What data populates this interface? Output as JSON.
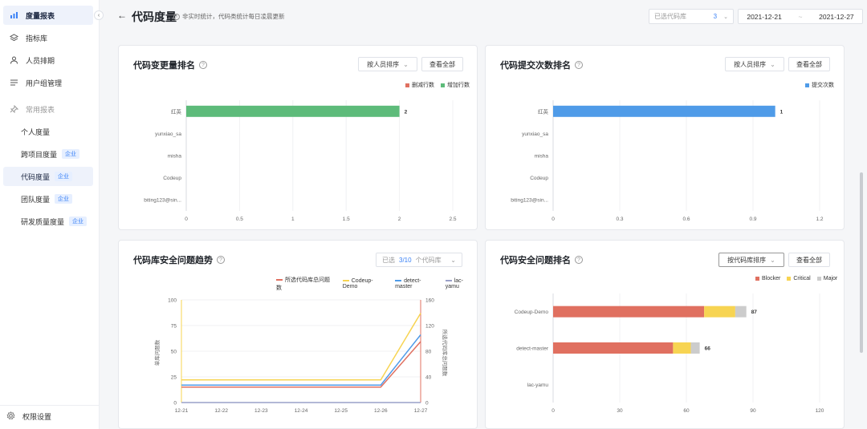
{
  "sidebar": {
    "items": [
      {
        "label": "度量报表",
        "icon": "chart-bars-icon",
        "active": true
      },
      {
        "label": "指标库",
        "icon": "layers-icon"
      },
      {
        "label": "人员排期",
        "icon": "user-icon"
      },
      {
        "label": "用户组管理",
        "icon": "list-icon"
      }
    ],
    "section_label": "常用报表",
    "section_icon": "pin-icon",
    "sub_items": [
      {
        "label": "个人度量",
        "badge": ""
      },
      {
        "label": "跨项目度量",
        "badge": "企业"
      },
      {
        "label": "代码度量",
        "badge": "企业",
        "active": true
      },
      {
        "label": "团队度量",
        "badge": "企业"
      },
      {
        "label": "研发质量度量",
        "badge": "企业"
      }
    ],
    "settings_label": "权限设置",
    "collapse_icon": "chevron-left-icon"
  },
  "header": {
    "back_icon": "arrow-left-icon",
    "title": "代码度量",
    "note": "非实时统计，代码类统计每日凌晨更新",
    "repo_placeholder": "已选代码库",
    "repo_count": "3",
    "date_start": "2021-12-21",
    "date_sep": "~",
    "date_end": "2021-12-27"
  },
  "cards": {
    "change": {
      "title": "代码变更量排名",
      "sort_label": "按人员排序",
      "view_all": "查看全部",
      "legend": [
        "删减行数",
        "增加行数"
      ]
    },
    "commit": {
      "title": "代码提交次数排名",
      "sort_label": "按人员排序",
      "view_all": "查看全部",
      "legend": [
        "提交次数"
      ]
    },
    "trend": {
      "title": "代码库安全问题趋势",
      "sel_prefix": "已选",
      "sel_count": "3/10",
      "sel_suffix": "个代码库",
      "legend": [
        "所选代码库总问题数",
        "Codeup-Demo",
        "detect-master",
        "lac-yamu"
      ],
      "ylabel_left": "单库问题数",
      "ylabel_right": "所选代码库总问题数"
    },
    "security": {
      "title": "代码安全问题排名",
      "sort_label": "按代码库排序",
      "view_all": "查看全部",
      "legend": [
        "Blocker",
        "Critical",
        "Major"
      ]
    }
  },
  "colors": {
    "green": "#5dbb7a",
    "blue": "#4f9be8",
    "red": "#e07060",
    "yellow": "#f7d452",
    "gray": "#cccccc",
    "accent": "#3b82f6"
  },
  "chart_data": [
    {
      "type": "bar",
      "orientation": "horizontal",
      "categories": [
        "红英",
        "yunxiao_sa",
        "misha",
        "Codeup",
        "biting123@sin..."
      ],
      "series": [
        {
          "name": "删减行数",
          "values": [
            0,
            0,
            0,
            0,
            0
          ]
        },
        {
          "name": "增加行数",
          "values": [
            2,
            0,
            0,
            0,
            0
          ]
        }
      ],
      "data_labels": [
        "2",
        "",
        "",
        "",
        ""
      ],
      "xticks": [
        "0",
        "0.5",
        "1",
        "1.5",
        "2",
        "2.5"
      ],
      "xlim": [
        0,
        2.5
      ]
    },
    {
      "type": "bar",
      "orientation": "horizontal",
      "categories": [
        "红英",
        "yunxiao_sa",
        "misha",
        "Codeup",
        "biting123@sin..."
      ],
      "series": [
        {
          "name": "提交次数",
          "values": [
            1,
            0,
            0,
            0,
            0
          ]
        }
      ],
      "data_labels": [
        "1",
        "",
        "",
        "",
        ""
      ],
      "xticks": [
        "0",
        "0.3",
        "0.6",
        "0.9",
        "1.2"
      ],
      "xlim": [
        0,
        1.2
      ]
    },
    {
      "type": "line",
      "x": [
        "12-21",
        "12-22",
        "12-23",
        "12-24",
        "12-25",
        "12-26",
        "12-27"
      ],
      "series": [
        {
          "name": "所选代码库总问题数",
          "axis": "right",
          "values": [
            24,
            24,
            24,
            24,
            24,
            24,
            95
          ]
        },
        {
          "name": "Codeup-Demo",
          "axis": "left",
          "values": [
            22,
            22,
            22,
            22,
            22,
            22,
            87
          ]
        },
        {
          "name": "detect-master",
          "axis": "left",
          "values": [
            17,
            17,
            17,
            17,
            17,
            17,
            66
          ]
        },
        {
          "name": "lac-yamu",
          "axis": "left",
          "values": [
            0,
            0,
            0,
            0,
            0,
            0,
            0
          ]
        }
      ],
      "yticks_left": [
        "0",
        "25",
        "50",
        "75",
        "100"
      ],
      "yticks_right": [
        "0",
        "40",
        "80",
        "120",
        "160"
      ],
      "ylim_left": [
        0,
        100
      ],
      "ylim_right": [
        0,
        160
      ]
    },
    {
      "type": "bar",
      "orientation": "horizontal",
      "stacked": true,
      "categories": [
        "Codeup-Demo",
        "detect-master",
        "lac-yamu"
      ],
      "series": [
        {
          "name": "Blocker",
          "values": [
            68,
            54,
            0
          ]
        },
        {
          "name": "Critical",
          "values": [
            14,
            8,
            0
          ]
        },
        {
          "name": "Major",
          "values": [
            5,
            4,
            0
          ]
        }
      ],
      "data_labels": [
        "87",
        "66",
        ""
      ],
      "xticks": [
        "0",
        "30",
        "60",
        "90",
        "120"
      ],
      "xlim": [
        0,
        120
      ]
    }
  ]
}
